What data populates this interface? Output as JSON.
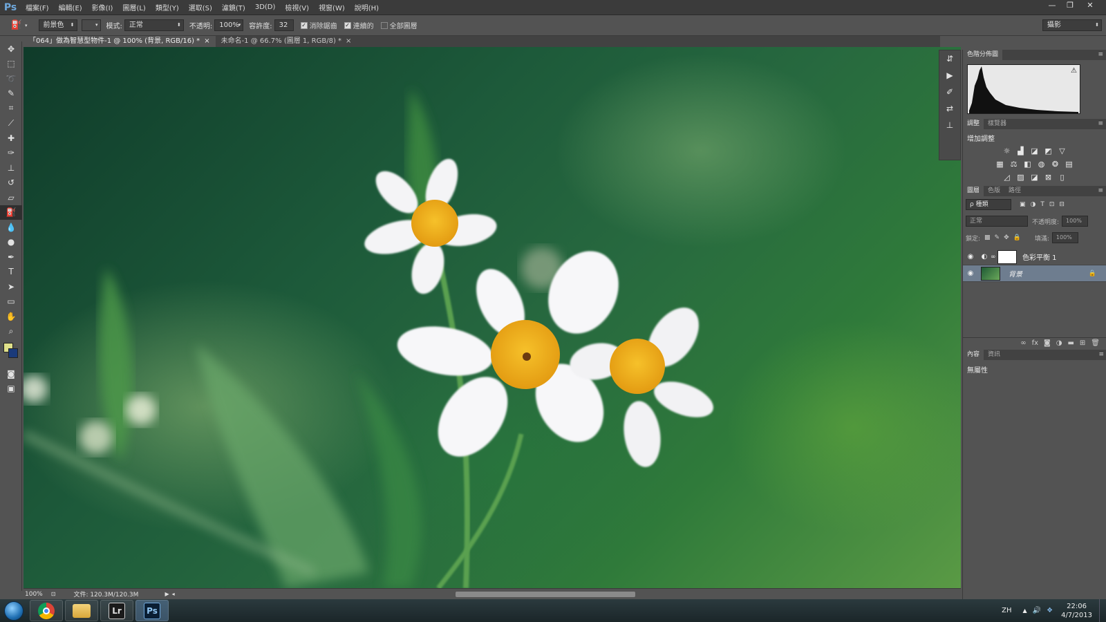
{
  "app": {
    "logo": "Ps"
  },
  "menu": [
    "檔案(F)",
    "編輯(E)",
    "影像(I)",
    "圖層(L)",
    "類型(Y)",
    "選取(S)",
    "濾鏡(T)",
    "3D(D)",
    "檢視(V)",
    "視窗(W)",
    "說明(H)"
  ],
  "window_controls": {
    "minimize": "—",
    "restore": "❐",
    "close": "✕"
  },
  "options": {
    "fill_source": "前景色",
    "mode_label": "模式:",
    "mode_value": "正常",
    "opacity_label": "不透明:",
    "opacity_value": "100%",
    "tolerance_label": "容許度:",
    "tolerance_value": "32",
    "antialias_label": "消除鋸齒",
    "contiguous_label": "連續的",
    "all_layers_label": "全部圖層",
    "workspace": "攝影"
  },
  "tabs": [
    {
      "label": "「064」做為智慧型物件-1 @ 100% (背景, RGB/16) *",
      "close": "×"
    },
    {
      "label": "未命名-1 @ 66.7% (圖層 1, RGB/8) *",
      "close": "×"
    }
  ],
  "status": {
    "zoom": "100%",
    "doc_info": "文件: 120.3M/120.3M"
  },
  "panels": {
    "histogram_tab": "色階分佈圖",
    "adjust_tabs": [
      "調整",
      "樣覽器"
    ],
    "add_adjustment": "增加調整",
    "layers_tabs": [
      "圖層",
      "色版",
      "路徑"
    ],
    "kind_filter": "ρ 種類",
    "blend_mode": "正常",
    "opacity_label": "不透明度:",
    "opacity_value": "100%",
    "lock_label": "鎖定:",
    "fill_label": "填滿:",
    "fill_value": "100%",
    "layers": [
      {
        "name": "色彩平衡 1"
      },
      {
        "name": "背景"
      }
    ],
    "props_tabs": [
      "內容",
      "資訊"
    ],
    "no_properties": "無屬性"
  },
  "taskbar": {
    "apps": [
      {
        "label": ""
      },
      {
        "label": ""
      },
      {
        "label": "Lr"
      },
      {
        "label": "Ps"
      }
    ],
    "lang": "ZH",
    "time": "22:06",
    "date": "4/7/2013"
  }
}
